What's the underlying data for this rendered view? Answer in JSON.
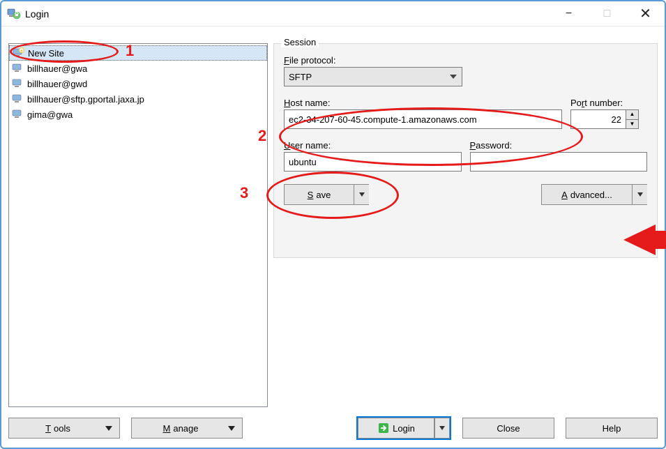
{
  "window": {
    "title": "Login"
  },
  "sites": [
    {
      "label": "New Site",
      "selected": true
    },
    {
      "label": "billhauer@gwa",
      "selected": false
    },
    {
      "label": "billhauer@gwd",
      "selected": false
    },
    {
      "label": "billhauer@sftp.gportal.jaxa.jp",
      "selected": false
    },
    {
      "label": "gima@gwa",
      "selected": false
    }
  ],
  "session": {
    "legend": "Session",
    "file_protocol_label": "File protocol:",
    "file_protocol_value": "SFTP",
    "host_label": "Host name:",
    "host_value": "ec2-34-207-60-45.compute-1.amazonaws.com",
    "host_accel": "H",
    "port_label": "Port number:",
    "port_value": "22",
    "port_accel": "R",
    "user_label": "User name:",
    "user_value": "ubuntu",
    "user_accel": "U",
    "pass_label": "Password:",
    "pass_value": "",
    "pass_accel": "P",
    "save_label": "Save",
    "save_accel": "S",
    "advanced_label": "Advanced...",
    "advanced_accel": "A"
  },
  "bottom": {
    "tools": "Tools",
    "manage": "Manage",
    "login": "Login",
    "close": "Close",
    "help": "Help"
  },
  "annotations": {
    "n1": "1",
    "n2": "2",
    "n3": "3"
  }
}
